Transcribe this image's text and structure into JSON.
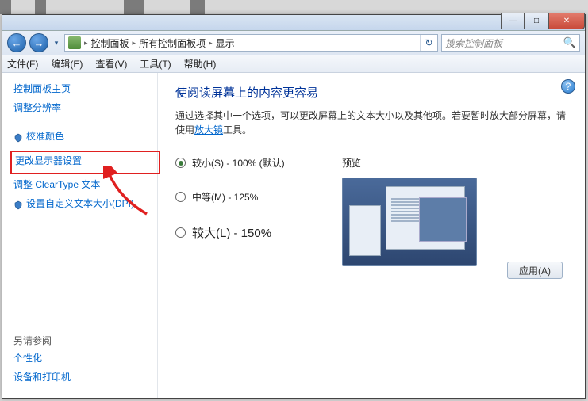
{
  "titlebar": {
    "min": "—",
    "max": "□",
    "close": "✕"
  },
  "nav": {
    "back": "←",
    "fwd": "→",
    "drop": "▾",
    "refresh": "↻"
  },
  "breadcrumb": {
    "seg1": "控制面板",
    "seg2": "所有控制面板项",
    "seg3": "显示",
    "sep": "▸"
  },
  "search": {
    "placeholder": "搜索控制面板",
    "icon": "🔍"
  },
  "menu": {
    "file": "文件(F)",
    "edit": "编辑(E)",
    "view": "查看(V)",
    "tools": "工具(T)",
    "help": "帮助(H)"
  },
  "sidebar": {
    "home": "控制面板主页",
    "adjust_res": "调整分辨率",
    "calibrate": "校准颜色",
    "change_display": "更改显示器设置",
    "cleartype": "调整 ClearType 文本",
    "dpi": "设置自定义文本大小(DPI)",
    "see_also_hdr": "另请参阅",
    "personalize": "个性化",
    "devices": "设备和打印机"
  },
  "content": {
    "heading": "使阅读屏幕上的内容更容易",
    "descr1": "通过选择其中一个选项，可以更改屏幕上的文本大小以及其他项。若要暂时放大部分屏幕，请使用",
    "descr_link": "放大镜",
    "descr2": "工具。",
    "opt_small": "较小(S) - 100% (默认)",
    "opt_medium": "中等(M) - 125%",
    "opt_large": "较大(L) - 150%",
    "preview_label": "预览",
    "apply": "应用(A)",
    "help": "?"
  }
}
